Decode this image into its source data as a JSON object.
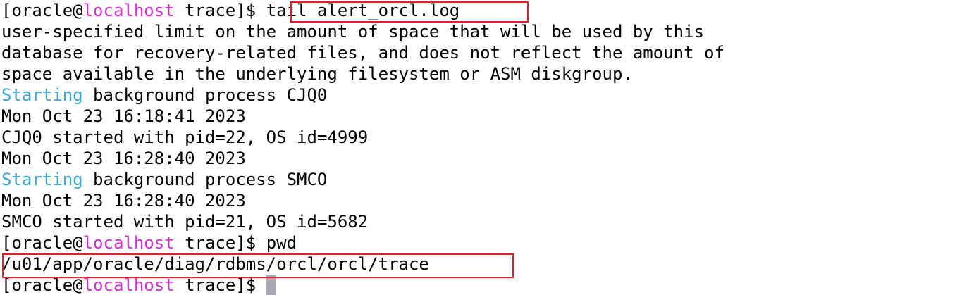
{
  "colors": {
    "background": "#ffffff",
    "text": "#000000",
    "host": "#d42fd4",
    "keyword": "#3aa7d8",
    "highlight": "#e0202a",
    "cursor": "#a8a8b4"
  },
  "prompt": {
    "open": "[oracle@",
    "host": "localhost",
    "close": " trace]$ "
  },
  "command1": "tail alert_orcl.log",
  "output": {
    "line1": "user-specified limit on the amount of space that will be used by this",
    "line2": "database for recovery-related files, and does not reflect the amount of",
    "line3": "space available in the underlying filesystem or ASM diskgroup.",
    "starting_word": "Starting",
    "line4_rest": " background process CJQ0",
    "line5": "Mon Oct 23 16:18:41 2023",
    "line6": "CJQ0 started with pid=22, OS id=4999",
    "line7": "Mon Oct 23 16:28:40 2023",
    "line8_rest": " background process SMCO",
    "line9": "Mon Oct 23 16:28:40 2023",
    "line10": "SMCO started with pid=21, OS id=5682"
  },
  "command2": "pwd",
  "pwd_output": "/u01/app/oracle/diag/rdbms/orcl/orcl/trace"
}
